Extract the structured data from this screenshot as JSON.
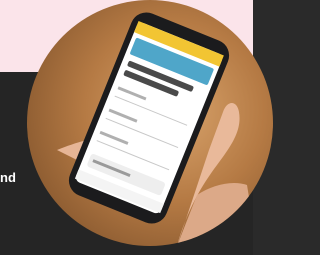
{
  "partial_text": "nd",
  "colors": {
    "top_band": "#fbe4ea",
    "dark_panel": "#252525",
    "photo_bg": "#b57a44",
    "phone_body": "#1b1b1d",
    "screen_header": "#f2c533"
  },
  "icons": [
    "smartphone-icon",
    "hand-icon"
  ]
}
